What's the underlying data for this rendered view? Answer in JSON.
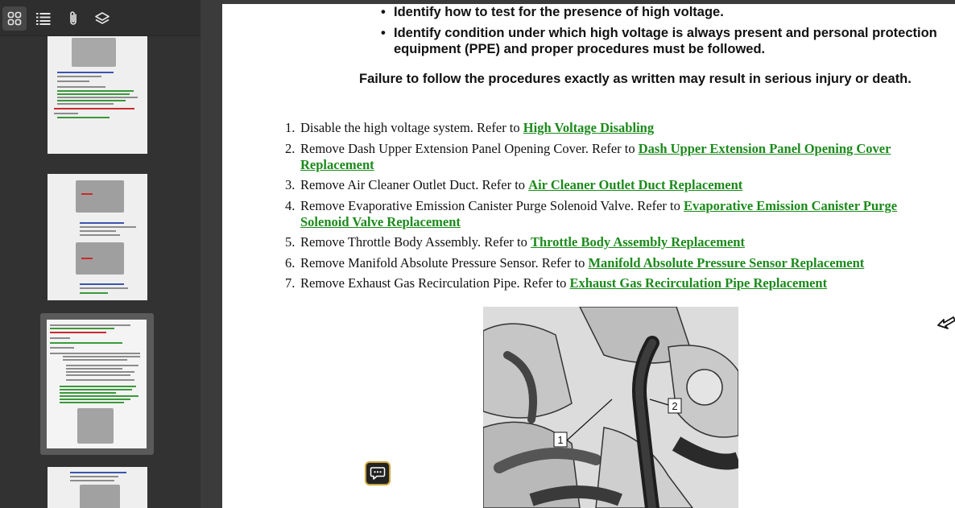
{
  "sidebar": {
    "toolbar": [
      {
        "name": "thumbnails-icon",
        "active": true
      },
      {
        "name": "outline-icon",
        "active": false
      },
      {
        "name": "attachments-icon",
        "active": false
      },
      {
        "name": "layers-icon",
        "active": false
      }
    ]
  },
  "document": {
    "bullets": [
      "Identify how to test for the presence of high voltage.",
      "Identify condition under which high voltage is always present and personal protection equipment (PPE) and proper procedures must be followed."
    ],
    "warning": "Failure to follow the procedures exactly as written may result in serious injury or death.",
    "steps": [
      {
        "num": "1.",
        "text": "Disable the high voltage system. Refer to ",
        "link": "High Voltage Disabling"
      },
      {
        "num": "2.",
        "text": "Remove Dash Upper Extension Panel Opening Cover. Refer to ",
        "link": "Dash Upper Extension Panel Opening Cover Replacement"
      },
      {
        "num": "3.",
        "text": "Remove Air Cleaner Outlet Duct. Refer to ",
        "link": "Air Cleaner Outlet Duct Replacement"
      },
      {
        "num": "4.",
        "text": "Remove Evaporative Emission Canister Purge Solenoid Valve. Refer to ",
        "link": "Evaporative Emission Canister Purge Solenoid Valve Replacement"
      },
      {
        "num": "5.",
        "text": "Remove Throttle Body Assembly. Refer to ",
        "link": "Throttle Body Assembly Replacement"
      },
      {
        "num": "6.",
        "text": "Remove Manifold Absolute Pressure Sensor. Refer to ",
        "link": "Manifold Absolute Pressure Sensor Replacement"
      },
      {
        "num": "7.",
        "text": "Remove Exhaust Gas Recirculation Pipe. Refer to ",
        "link": "Exhaust Gas Recirculation Pipe Replacement"
      }
    ],
    "figure": {
      "callouts": [
        "1",
        "2"
      ]
    }
  },
  "colors": {
    "link": "#1b8a1b",
    "sidebar_bg": "#323232",
    "viewer_bg": "#3b3b3b",
    "accent_border": "#caa53a"
  }
}
